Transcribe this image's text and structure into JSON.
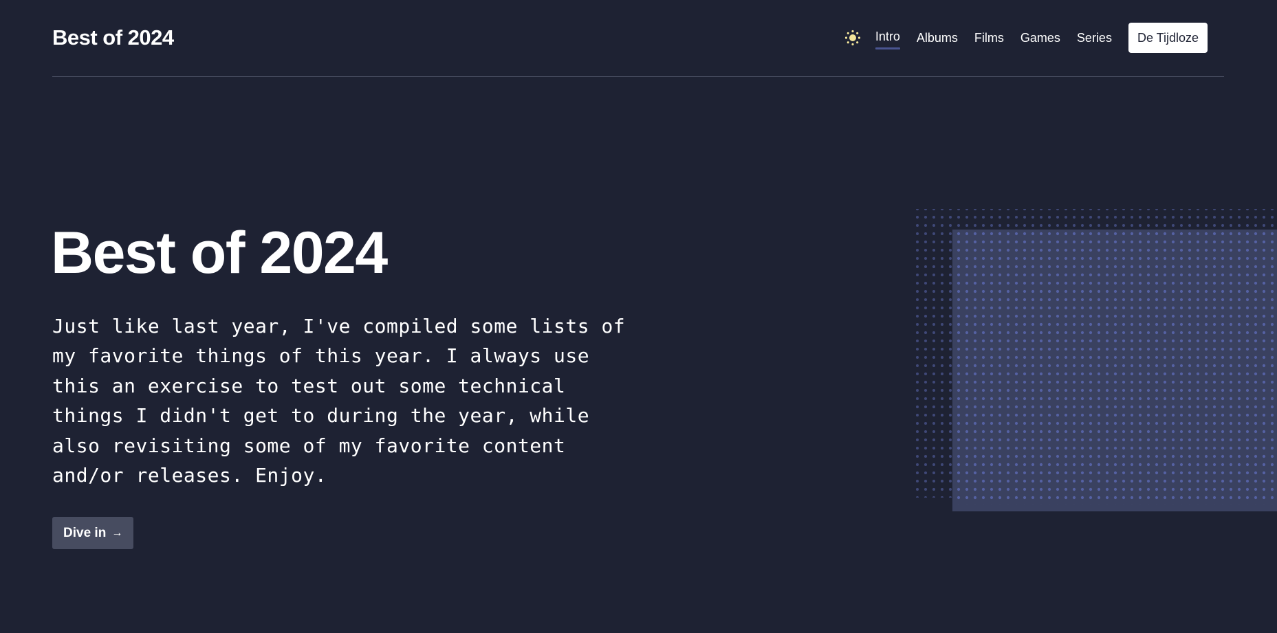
{
  "header": {
    "site_title": "Best of 2024",
    "theme_icon": "sun-icon",
    "nav": [
      {
        "label": "Intro",
        "active": true
      },
      {
        "label": "Albums",
        "active": false
      },
      {
        "label": "Films",
        "active": false
      },
      {
        "label": "Games",
        "active": false
      },
      {
        "label": "Series",
        "active": false
      }
    ],
    "cta_label": "De Tijdloze"
  },
  "hero": {
    "title": "Best of 2024",
    "intro": "Just like last year, I've compiled some lists of my favorite things of this year. I always use this an exercise to test out some technical things I didn't get to during the year, while also revisiting some of my favorite content and/or releases. Enjoy.",
    "button_label": "Dive in",
    "button_icon": "arrow-right-icon"
  },
  "colors": {
    "background": "#1e2233",
    "accent": "#4a5590",
    "button": "#474c60",
    "sun": "#f3e59a",
    "panel": "#3a4160",
    "dots": "#5460a0"
  }
}
